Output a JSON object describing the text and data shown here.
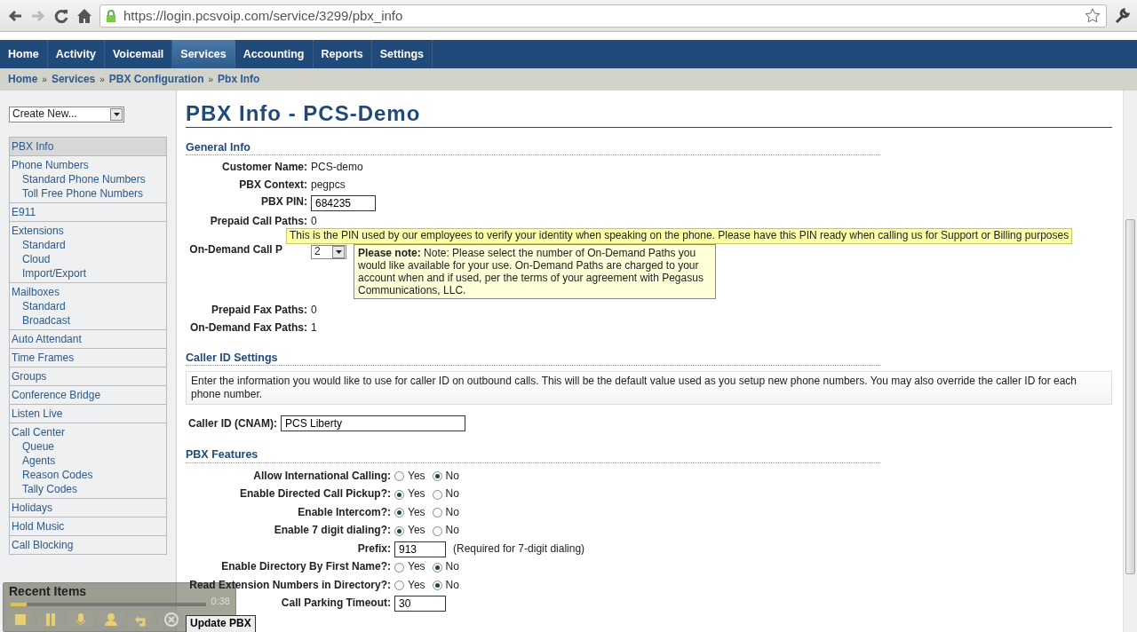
{
  "browser": {
    "url": "https://login.pcsvoip.com/service/3299/pbx_info"
  },
  "nav": [
    {
      "label": "Home",
      "selected": false
    },
    {
      "label": "Activity",
      "selected": false
    },
    {
      "label": "Voicemail",
      "selected": false
    },
    {
      "label": "Services",
      "selected": true
    },
    {
      "label": "Accounting",
      "selected": false
    },
    {
      "label": "Reports",
      "selected": false
    },
    {
      "label": "Settings",
      "selected": false
    }
  ],
  "breadcrumb": [
    "Home",
    "Services",
    "PBX Configuration",
    "Pbx Info"
  ],
  "breadcrumb_separator": "»",
  "sidebar": {
    "create_select": "Create New...",
    "items": [
      {
        "label": "PBX Info",
        "selected": true
      },
      {
        "label": "Phone Numbers",
        "selected": false,
        "children": [
          {
            "label": "Standard Phone Numbers"
          },
          {
            "label": "Toll Free Phone Numbers"
          }
        ]
      },
      {
        "label": "E911",
        "selected": false
      },
      {
        "label": "Extensions",
        "selected": false,
        "children": [
          {
            "label": "Standard"
          },
          {
            "label": "Cloud"
          },
          {
            "label": "Import/Export"
          }
        ]
      },
      {
        "label": "Mailboxes",
        "selected": false,
        "children": [
          {
            "label": "Standard"
          },
          {
            "label": "Broadcast"
          }
        ]
      },
      {
        "label": "Auto Attendant",
        "selected": false
      },
      {
        "label": "Time Frames",
        "selected": false
      },
      {
        "label": "Groups",
        "selected": false
      },
      {
        "label": "Conference Bridge",
        "selected": false
      },
      {
        "label": "Listen Live",
        "selected": false
      },
      {
        "label": "Call Center",
        "selected": false,
        "children": [
          {
            "label": "Queue"
          },
          {
            "label": "Agents"
          },
          {
            "label": "Reason Codes"
          },
          {
            "label": "Tally Codes"
          }
        ]
      },
      {
        "label": "Holidays",
        "selected": false
      },
      {
        "label": "Hold Music",
        "selected": false
      },
      {
        "label": "Call Blocking",
        "selected": false
      }
    ],
    "recent": {
      "title": "Recent Items"
    }
  },
  "player": {
    "time": "0:38",
    "level": 0.08
  },
  "title": "PBX Info - PCS-Demo",
  "general": {
    "heading": "General Info",
    "rows": [
      {
        "kind": "text",
        "label": "Customer Name:",
        "value": "PCS-demo"
      },
      {
        "kind": "text",
        "label": "PBX Context:",
        "value": "pegpcs"
      },
      {
        "kind": "input",
        "label": "PBX PIN:",
        "value": "684235"
      },
      {
        "kind": "text",
        "label": "Prepaid Call Paths:",
        "value": "0"
      },
      {
        "kind": "select",
        "label": "On-Demand Call P",
        "value": "2",
        "note_bold": "Please note:",
        "note": "Note: Please select the number of On-Demand Paths you would like available for your use. On-Demand Paths are charged to your account when and if used, per the terms of your agreement with Pegasus Communications, LLC."
      },
      {
        "kind": "text",
        "label": "Prepaid Fax Paths:",
        "value": "0"
      },
      {
        "kind": "text",
        "label": "On-Demand Fax Paths:",
        "value": "1"
      }
    ],
    "tooltip": "This is the PIN used by our employees to verify your identity when speaking on the phone. Please have this PIN ready when calling us for Support or Billing purposes"
  },
  "caller_id": {
    "heading": "Caller ID Settings",
    "info": "Enter the information you would like to use for caller ID on outbound calls. This will be the default value used as you setup new phone numbers. You may also override the caller ID for each phone number.",
    "label": "Caller ID (CNAM):",
    "value": "PCS Liberty"
  },
  "features": {
    "heading": "PBX Features",
    "rows": [
      {
        "kind": "radio",
        "label": "Allow International Calling:",
        "options": [
          {
            "label": "Yes",
            "selected": false
          },
          {
            "label": "No",
            "selected": true
          }
        ]
      },
      {
        "kind": "radio",
        "label": "Enable Directed Call Pickup?:",
        "options": [
          {
            "label": "Yes",
            "selected": true
          },
          {
            "label": "No",
            "selected": false
          }
        ]
      },
      {
        "kind": "radio",
        "label": "Enable Intercom?:",
        "options": [
          {
            "label": "Yes",
            "selected": true
          },
          {
            "label": "No",
            "selected": false
          }
        ]
      },
      {
        "kind": "radio",
        "label": "Enable 7 digit dialing?:",
        "options": [
          {
            "label": "Yes",
            "selected": true
          },
          {
            "label": "No",
            "selected": false
          }
        ]
      },
      {
        "kind": "input",
        "label": "Prefix:",
        "value": "913",
        "hint": "(Required for 7-digit dialing)"
      },
      {
        "kind": "radio",
        "label": "Enable Directory By First Name?:",
        "options": [
          {
            "label": "Yes",
            "selected": false
          },
          {
            "label": "No",
            "selected": true
          }
        ]
      },
      {
        "kind": "radio",
        "label": "Read Extension Numbers in Directory?:",
        "options": [
          {
            "label": "Yes",
            "selected": false
          },
          {
            "label": "No",
            "selected": true
          }
        ]
      },
      {
        "kind": "input",
        "label": "Call Parking Timeout:",
        "value": "30"
      }
    ]
  },
  "submit": "Update PBX"
}
